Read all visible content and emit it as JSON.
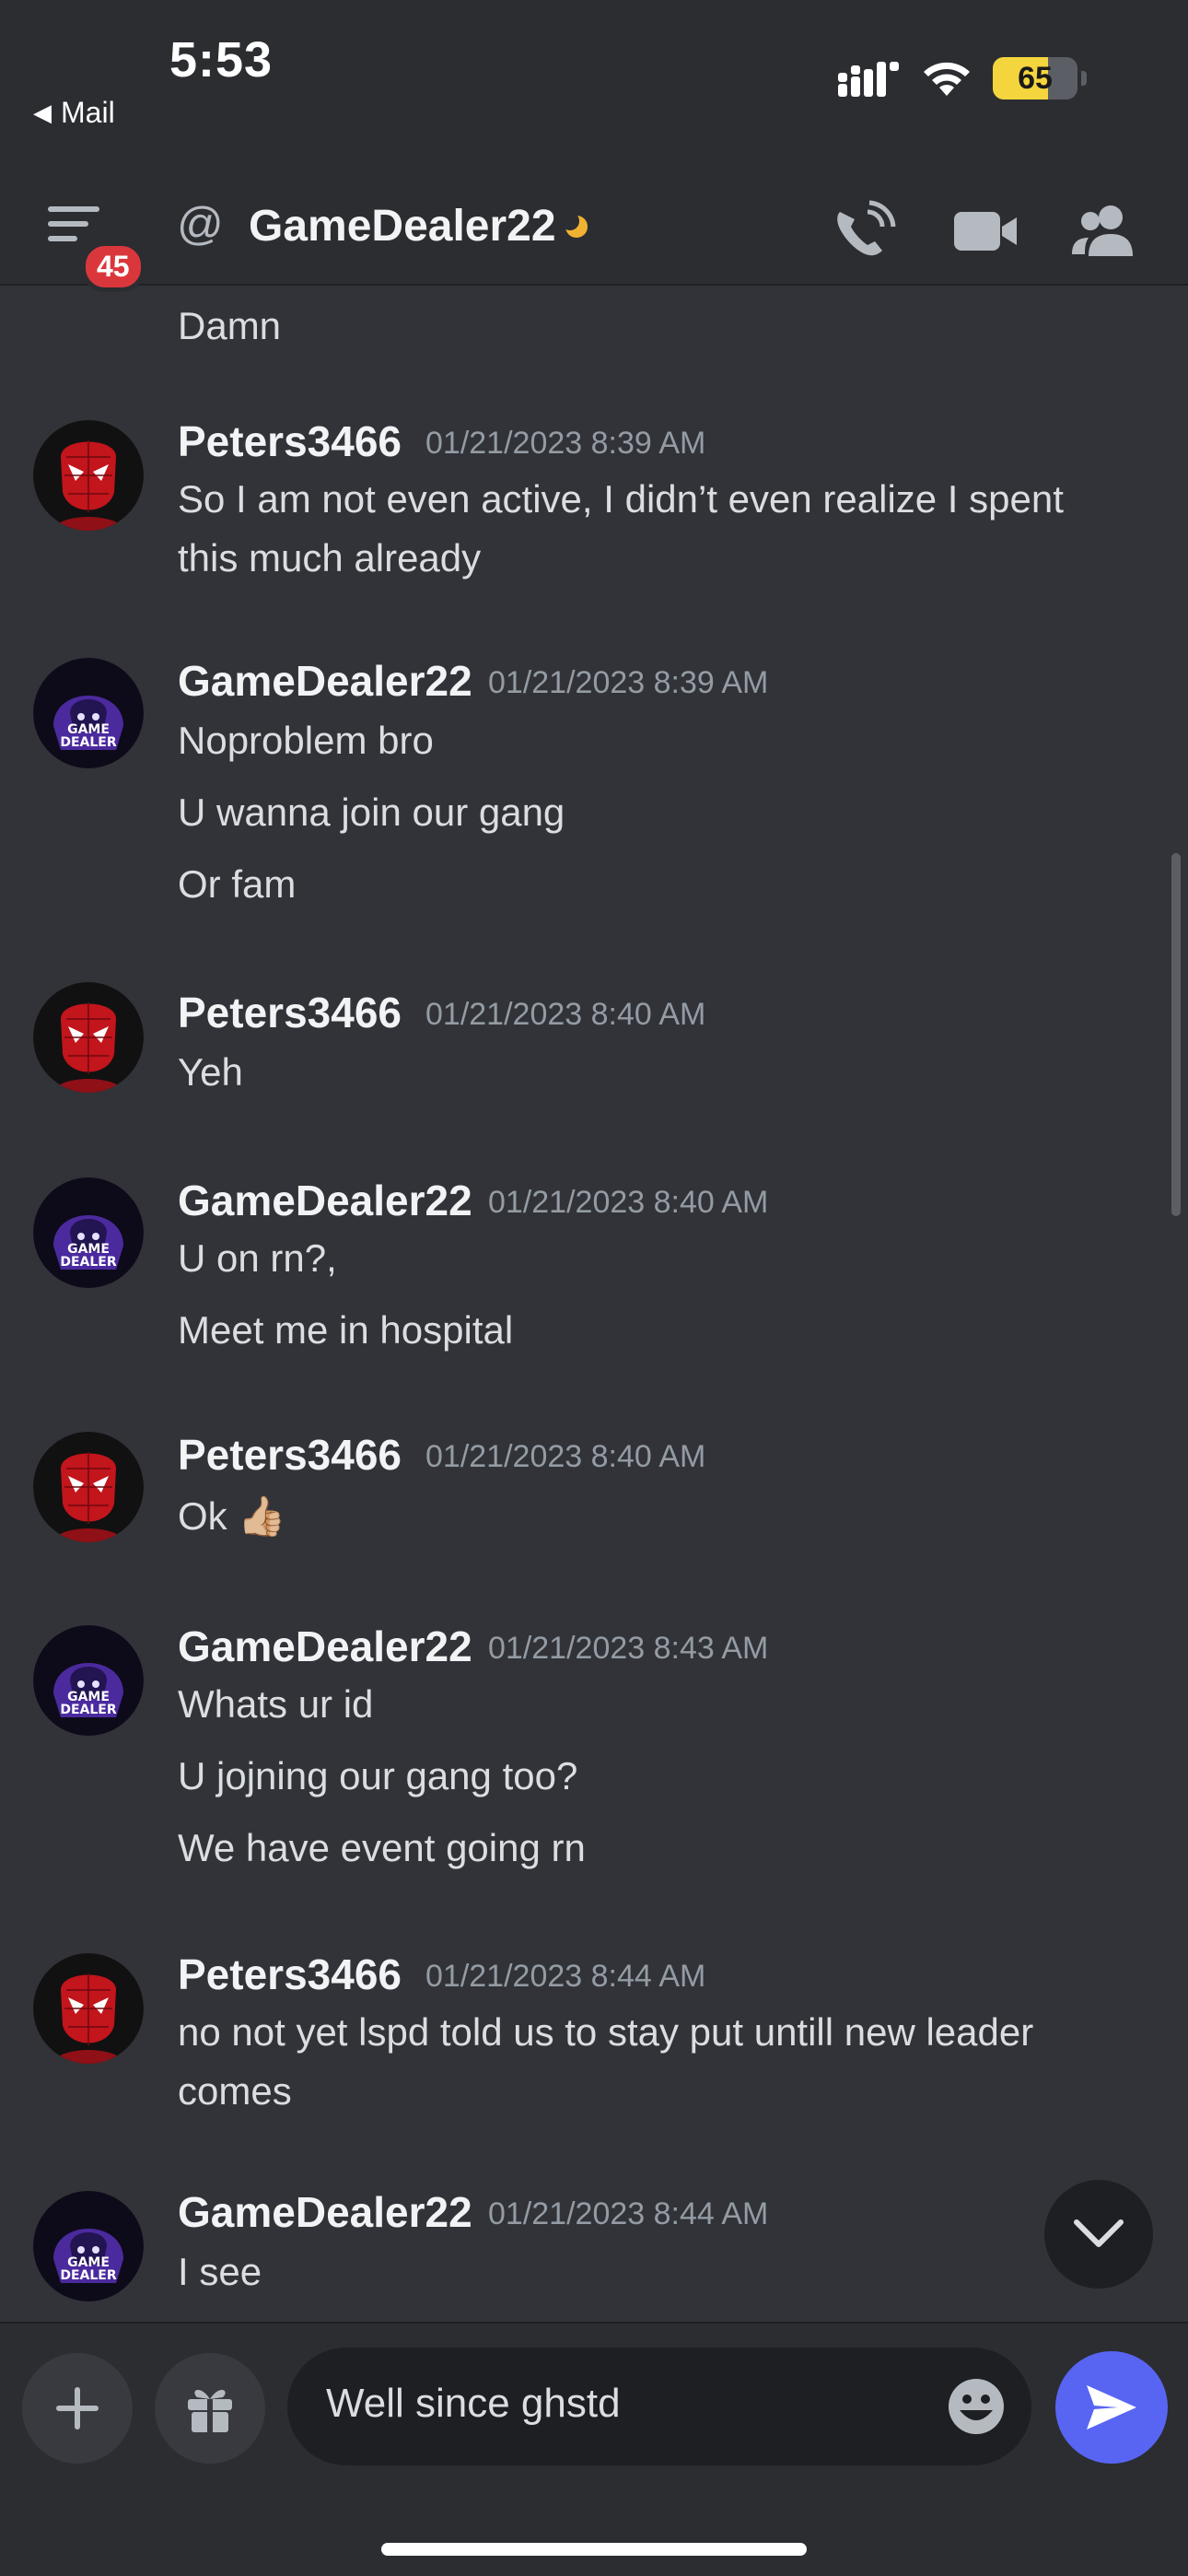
{
  "status_bar": {
    "time": "5:53",
    "back_label": "Mail",
    "battery": "65"
  },
  "header": {
    "unread_badge": "45",
    "channel_name": "GameDealer22",
    "status": "idle"
  },
  "messages": [
    {
      "author": "",
      "timestamp": "",
      "lines": [
        "Damn"
      ]
    },
    {
      "author": "Peters3466",
      "timestamp": "01/21/2023 8:39 AM",
      "avatar": "spiderman-avatar",
      "lines": [
        "So I am not even active, I didn’t even realize I spent",
        "this much already"
      ]
    },
    {
      "author": "GameDealer22",
      "timestamp": "01/21/2023 8:39 AM",
      "avatar": "game-dealer-avatar",
      "avatar_text": [
        "GAME",
        "DEALER"
      ],
      "lines": [
        "Noproblem bro",
        "U wanna join our gang",
        "Or fam"
      ]
    },
    {
      "author": "Peters3466",
      "timestamp": "01/21/2023 8:40 AM",
      "avatar": "spiderman-avatar",
      "lines": [
        "Yeh"
      ]
    },
    {
      "author": "GameDealer22",
      "timestamp": "01/21/2023 8:40 AM",
      "avatar": "game-dealer-avatar",
      "lines": [
        "U on rn?,",
        "Meet me in hospital"
      ]
    },
    {
      "author": "Peters3466",
      "timestamp": "01/21/2023 8:40 AM",
      "avatar": "spiderman-avatar",
      "lines": [
        "Ok"
      ],
      "emoji": "👍🏼"
    },
    {
      "author": "GameDealer22",
      "timestamp": "01/21/2023 8:43 AM",
      "avatar": "game-dealer-avatar",
      "lines": [
        "Whats ur id",
        "U jojning our gang too?",
        "We have event going rn"
      ]
    },
    {
      "author": "Peters3466",
      "timestamp": "01/21/2023 8:44 AM",
      "avatar": "spiderman-avatar",
      "lines": [
        "no not yet lspd told us to stay put untill new leader",
        "comes"
      ]
    },
    {
      "author": "GameDealer22",
      "timestamp": "01/21/2023 8:44 AM",
      "avatar": "game-dealer-avatar",
      "lines": [
        "I see"
      ]
    }
  ],
  "composer": {
    "input_value": "Well since ghstd"
  },
  "colors": {
    "background": "#313338",
    "header": "#2b2d31",
    "accent": "#5865f2",
    "badge": "#da373c",
    "idle": "#f0b232"
  }
}
